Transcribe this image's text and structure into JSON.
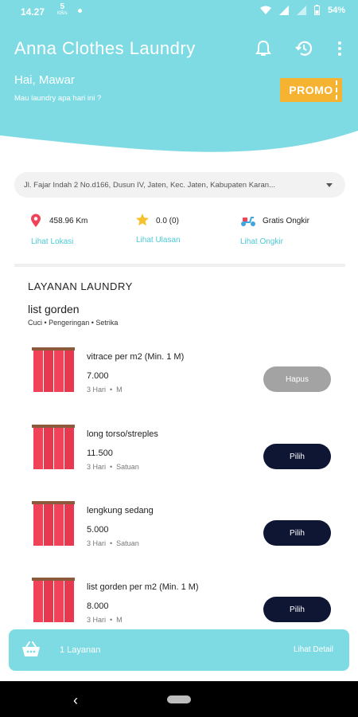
{
  "status_bar": {
    "time": "14.27",
    "net_speed": "5",
    "net_unit": "KB/s",
    "battery": "54%"
  },
  "header": {
    "title": "Anna Clothes Laundry",
    "greeting": "Hai, Mawar",
    "subtitle": "Mau laundry apa hari ini ?",
    "promo_label": "PROMO",
    "icons": [
      "bell-icon",
      "history-icon",
      "more-vert-icon"
    ]
  },
  "address": {
    "text": "Jl. Fajar Indah 2 No.d166, Dusun IV, Jaten, Kec. Jaten, Kabupaten Karan..."
  },
  "info": {
    "distance": {
      "value": "458.96 Km",
      "link": "Lihat Lokasi",
      "icon": "location-pin-icon"
    },
    "rating": {
      "value": "0.0 (0)",
      "link": "Lihat Ulasan",
      "icon": "star-icon"
    },
    "shipping": {
      "value": "Gratis Ongkir",
      "link": "Lihat Ongkir",
      "icon": "scooter-icon"
    }
  },
  "section": {
    "title": "LAYANAN LAUNDRY",
    "category": "list gorden",
    "category_desc": "Cuci • Pengeringan • Setrika"
  },
  "items": [
    {
      "name": "vitrace per m2 (Min. 1 M)",
      "price": "7.000",
      "duration": "3 Hari",
      "unit": "M",
      "button": "Hapus",
      "selected": true
    },
    {
      "name": "long torso/streples",
      "price": "11.500",
      "duration": "3 Hari",
      "unit": "Satuan",
      "button": "Pilih",
      "selected": false
    },
    {
      "name": "lengkung sedang",
      "price": "5.000",
      "duration": "3 Hari",
      "unit": "Satuan",
      "button": "Pilih",
      "selected": false
    },
    {
      "name": "list gorden per m2 (Min. 1 M)",
      "price": "8.000",
      "duration": "3 Hari",
      "unit": "M",
      "button": "Pilih",
      "selected": false
    }
  ],
  "cart": {
    "count_label": "1 Layanan",
    "detail_label": "Lihat Detail"
  },
  "colors": {
    "accent": "#7fdbe3",
    "promo": "#f6b332",
    "button_dark": "#0f1634",
    "button_grey": "#a3a3a3",
    "link": "#4ccad6",
    "curtain": "#f0435a"
  }
}
